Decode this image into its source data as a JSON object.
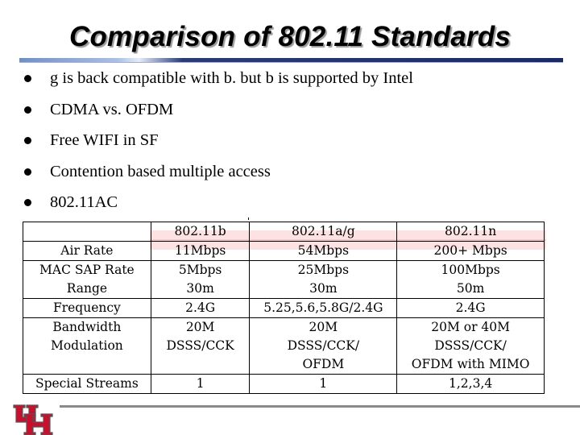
{
  "slide": {
    "title": "Comparison of 802.11 Standards",
    "bullets": [
      "g is back compatible with b. but b is supported by Intel",
      "CDMA vs. OFDM",
      "Free WIFI in SF",
      "Contention based multiple access",
      "802.11AC"
    ],
    "table": {
      "headers": [
        "",
        "802.11b",
        "802.11a/g",
        "802.11n"
      ],
      "rows": [
        {
          "label": "Air Rate",
          "values": [
            "11Mbps",
            "54Mbps",
            "200+ Mbps"
          ]
        },
        {
          "label": "MAC SAP Rate",
          "values": [
            "5Mbps",
            "25Mbps",
            "100Mbps"
          ]
        },
        {
          "label": "Range",
          "values": [
            "30m",
            "30m",
            "50m"
          ]
        },
        {
          "label": "Frequency",
          "values": [
            "2.4G",
            "5.25,5.6,5.8G/2.4G",
            "2.4G"
          ]
        },
        {
          "label": "Bandwidth",
          "values": [
            "20M",
            "20M",
            "20M or 40M"
          ]
        },
        {
          "label": "Modulation",
          "values": [
            "DSSS/CCK",
            "DSSS/CCK/",
            "DSSS/CCK/"
          ]
        },
        {
          "label": "",
          "values": [
            "",
            "OFDM",
            "OFDM with MIMO"
          ]
        },
        {
          "label": "Special Streams",
          "values": [
            "1",
            "1",
            "1,2,3,4"
          ]
        }
      ],
      "highlight_color": "#fde2e4"
    },
    "logo": {
      "icon": "uh-logo-icon",
      "text": "UH",
      "color": "#c8102e"
    }
  }
}
